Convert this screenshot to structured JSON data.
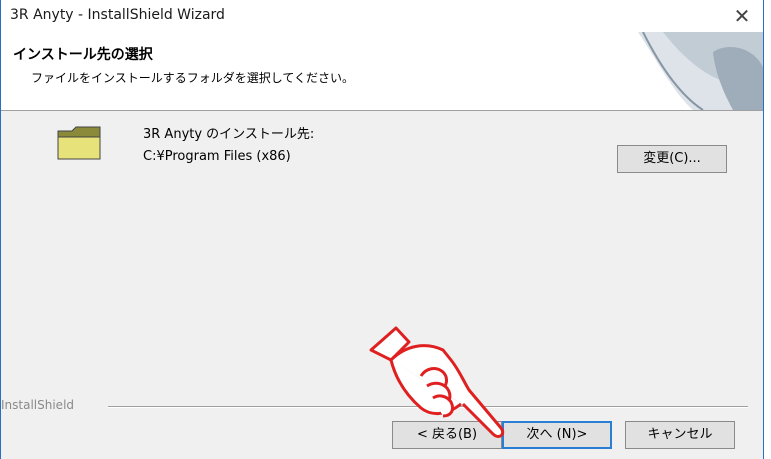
{
  "window": {
    "title": "3R Anyty - InstallShield Wizard",
    "close_icon": "close-icon"
  },
  "header": {
    "title": "インストール先の選択",
    "subtitle": "ファイルをインストールするフォルダを選択してください。"
  },
  "destination": {
    "label": "3R Anyty のインストール先:",
    "path": "C:¥Program Files (x86)",
    "change_label": "変更(C)..."
  },
  "footer": {
    "brand": "InstallShield",
    "back_label": "< 戻る(B)",
    "next_label": "次へ (N)>",
    "cancel_label": "キャンセル"
  },
  "colors": {
    "accent": "#2a7fd4",
    "pointer_hand": "#e02020"
  }
}
